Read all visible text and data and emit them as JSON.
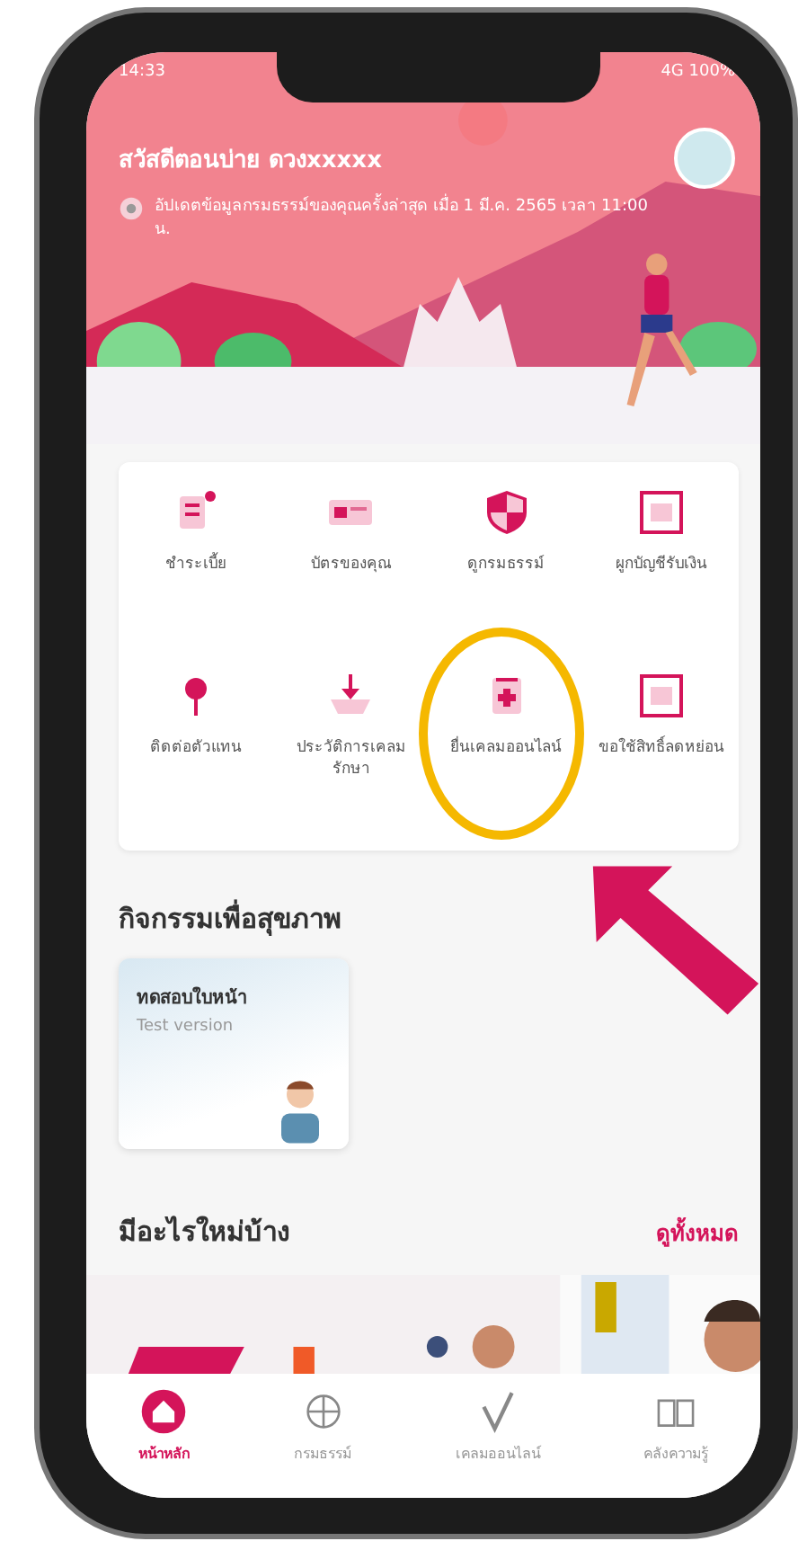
{
  "status_bar": {
    "time": "14:33",
    "battery": "4G 100%"
  },
  "header": {
    "greeting": "สวัสดีตอนบ่าย ดวงxxxxx",
    "info": "อัปเดตข้อมูลกรมธรรม์ของคุณครั้งล่าสุด เมื่อ 1 มี.ค. 2565 เวลา 11:00 น."
  },
  "menu": [
    {
      "label": "ชำระเบี้ย",
      "kind": "document",
      "highlighted": false
    },
    {
      "label": "บัตรของคุณ",
      "kind": "card",
      "highlighted": false
    },
    {
      "label": "ดูกรมธรรม์",
      "kind": "shield",
      "highlighted": false
    },
    {
      "label": "ผูกบัญชีรับเงิน",
      "kind": "calendar",
      "highlighted": false
    },
    {
      "label": "ติดต่อตัวแทน",
      "kind": "pin",
      "highlighted": false
    },
    {
      "label": "ประวัติการเคลม รักษา",
      "kind": "download",
      "highlighted": false
    },
    {
      "label": "ยื่นเคลมออนไลน์",
      "kind": "medical",
      "highlighted": true
    },
    {
      "label": "ขอใช้สิทธิ์ลดหย่อน",
      "kind": "calendar",
      "highlighted": false
    }
  ],
  "health": {
    "title": "กิจกรรมเพื่อสุขภาพ",
    "cards": [
      {
        "title": "ทดสอบใบหน้า",
        "subtitle": "Test version"
      }
    ]
  },
  "news": {
    "title": "มีอะไรใหม่บ้าง",
    "link": "ดูทั้งหมด"
  },
  "nav": [
    {
      "label": "หน้าหลัก",
      "kind": "home",
      "selected": true
    },
    {
      "label": "กรมธรรม์",
      "kind": "globe",
      "selected": false
    },
    {
      "label": "เคลมออนไลน์",
      "kind": "check",
      "selected": false
    },
    {
      "label": "คลังความรู้",
      "kind": "book",
      "selected": false
    }
  ]
}
